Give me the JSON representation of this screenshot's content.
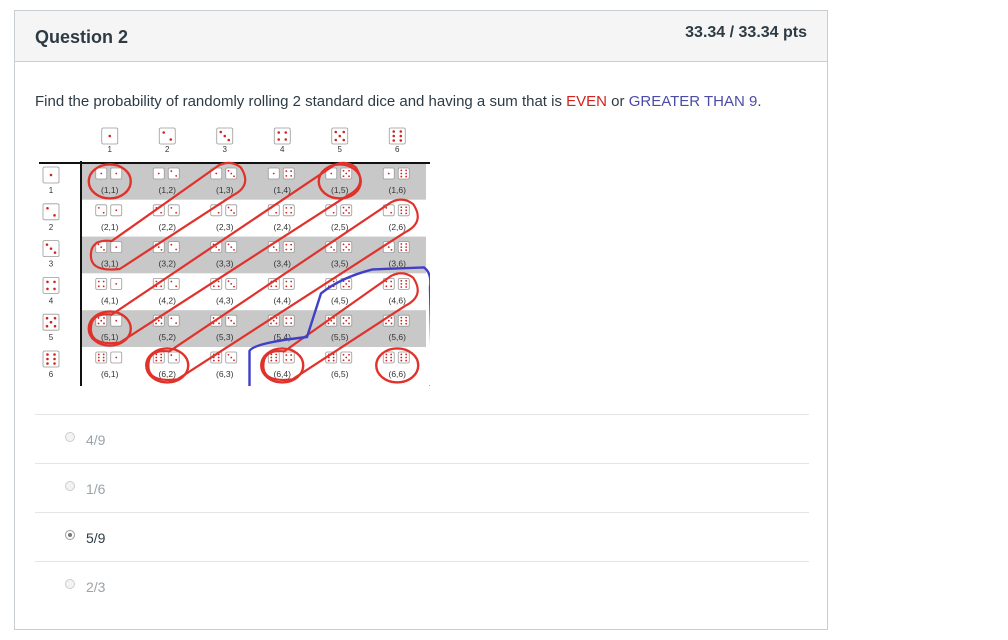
{
  "question": {
    "title": "Question 2",
    "points": "33.34 / 33.34 pts",
    "prompt_before": "Find the probability of randomly rolling 2 standard dice and having a sum that is ",
    "prompt_even": "EVEN",
    "prompt_or": " or ",
    "prompt_greater": "GREATER THAN 9",
    "prompt_end": "."
  },
  "dice_table": {
    "column_labels": [
      "1",
      "2",
      "3",
      "4",
      "5",
      "6"
    ],
    "row_labels": [
      "1",
      "2",
      "3",
      "4",
      "5",
      "6"
    ],
    "cells": [
      [
        "(1,1)",
        "(1,2)",
        "(1,3)",
        "(1,4)",
        "(1,5)",
        "(1,6)"
      ],
      [
        "(2,1)",
        "(2,2)",
        "(2,3)",
        "(2,4)",
        "(2,5)",
        "(2,6)"
      ],
      [
        "(3,1)",
        "(3,2)",
        "(3,3)",
        "(3,4)",
        "(3,5)",
        "(3,6)"
      ],
      [
        "(4,1)",
        "(4,2)",
        "(4,3)",
        "(4,4)",
        "(4,5)",
        "(4,6)"
      ],
      [
        "(5,1)",
        "(5,2)",
        "(5,3)",
        "(5,4)",
        "(5,5)",
        "(5,6)"
      ],
      [
        "(6,1)",
        "(6,2)",
        "(6,3)",
        "(6,4)",
        "(6,5)",
        "(6,6)"
      ]
    ],
    "even_marker_color": "#e0322b",
    "greater_marker_color": "#3f3fc8"
  },
  "answers": [
    {
      "label": "4/9",
      "selected": false
    },
    {
      "label": "1/6",
      "selected": false
    },
    {
      "label": "5/9",
      "selected": true
    },
    {
      "label": "2/3",
      "selected": false
    }
  ],
  "colors": {
    "even": "#d0231f",
    "greater_than_9": "#4b4ba8"
  }
}
